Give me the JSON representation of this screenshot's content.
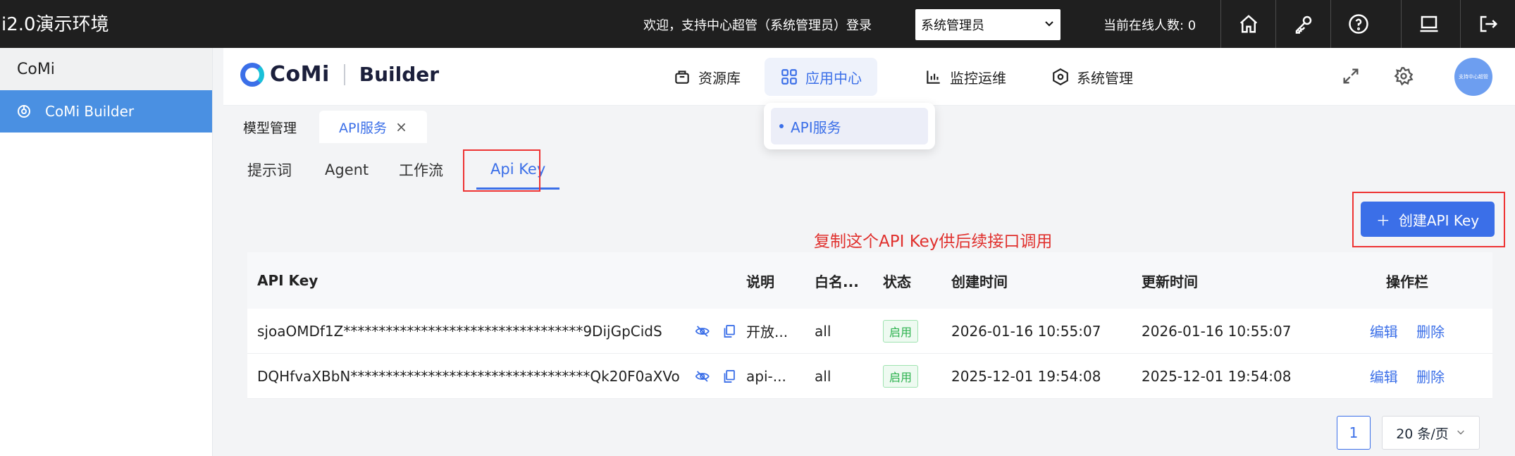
{
  "topbar": {
    "brand": "i2.0演示环境",
    "welcome": "欢迎，支持中心超管（系统管理员）登录",
    "role_selected": "系统管理员",
    "online": "当前在线人数: 0"
  },
  "sidebar": {
    "header": "CoMi",
    "items": [
      {
        "label": "CoMi Builder"
      }
    ]
  },
  "header": {
    "logo_text": "CoMi",
    "logo_builder": "Builder",
    "nav": [
      {
        "label": "资源库",
        "icon": "box-icon"
      },
      {
        "label": "应用中心",
        "icon": "grid-icon"
      },
      {
        "label": "监控运维",
        "icon": "chart-icon"
      },
      {
        "label": "系统管理",
        "icon": "hexagon-gear-icon"
      }
    ],
    "avatar_text": "支持中心超管"
  },
  "dropdown": {
    "items": [
      {
        "label": "API服务"
      }
    ]
  },
  "page_tabs": [
    {
      "label": "模型管理"
    },
    {
      "label": "API服务"
    }
  ],
  "sub_tabs": [
    {
      "label": "提示词"
    },
    {
      "label": "Agent"
    },
    {
      "label": "工作流"
    },
    {
      "label": "Api Key"
    }
  ],
  "create_button": "创建API Key",
  "annotation": "复制这个API Key供后续接口调用",
  "table": {
    "columns": [
      "API Key",
      "",
      "说明",
      "白名...",
      "状态",
      "创建时间",
      "更新时间",
      "操作栏"
    ],
    "rows": [
      {
        "key": "sjoaOMDf1Z**********************************9DijGpCidS",
        "desc": "开放...",
        "whitelist": "all",
        "status": "启用",
        "created": "2026-01-16 10:55:07",
        "updated": "2026-01-16 10:55:07",
        "edit": "编辑",
        "delete": "删除"
      },
      {
        "key": "DQHfvaXBbN**********************************Qk20F0aXVo",
        "desc": "api-...",
        "whitelist": "all",
        "status": "启用",
        "created": "2025-12-01 19:54:08",
        "updated": "2025-12-01 19:54:08",
        "edit": "编辑",
        "delete": "删除"
      }
    ]
  },
  "pagination": {
    "current_page": "1",
    "page_size": "20 条/页"
  },
  "colors": {
    "accent": "#3b6fe8",
    "sidebar_active": "#4a90e2",
    "highlight_box": "#e33333",
    "status_green": "#2bb14d"
  }
}
